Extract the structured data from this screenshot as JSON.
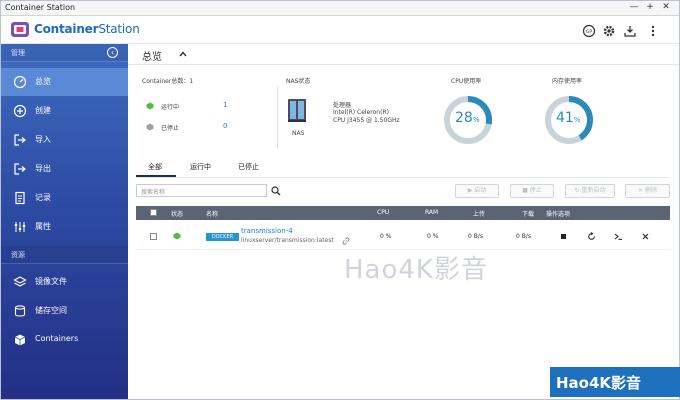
{
  "window": {
    "title": "Container Station",
    "controls": [
      "—",
      "+",
      "✕"
    ]
  },
  "header": {
    "brand_bold": "Container",
    "brand_thin": "Station"
  },
  "sidebar": {
    "section_manage": "管理",
    "section_resources": "资源",
    "items": [
      {
        "label": "总览",
        "icon": "dashboard-icon",
        "active": true
      },
      {
        "label": "创建",
        "icon": "create-icon",
        "active": false
      },
      {
        "label": "导入",
        "icon": "import-icon",
        "active": false
      },
      {
        "label": "导出",
        "icon": "export-icon",
        "active": false
      },
      {
        "label": "记录",
        "icon": "log-icon",
        "active": false
      },
      {
        "label": "属性",
        "icon": "properties-icon",
        "active": false
      }
    ],
    "resource_items": [
      {
        "label": "镜像文件",
        "icon": "layers-icon"
      },
      {
        "label": "储存空间",
        "icon": "storage-icon"
      },
      {
        "label": "Containers",
        "icon": "container-icon"
      }
    ]
  },
  "overview": {
    "title": "总览",
    "container_total_label": "Container总数：",
    "container_total": "1",
    "running_label": "运行中",
    "running_count": "1",
    "stopped_label": "已停止",
    "stopped_count": "0",
    "nas_status_label": "NAS状态",
    "nas_label": "NAS",
    "processor_label": "处理器",
    "processor_line1": "Intel(R) Celeron(R)",
    "processor_line2": "CPU J3455 @ 1.50GHz",
    "cpu_usage_label": "CPU使用率",
    "cpu_usage": "28",
    "mem_usage_label": "内存使用率",
    "mem_usage": "41",
    "pct": "%"
  },
  "tabs": [
    "全部",
    "运行中",
    "已停止"
  ],
  "search": {
    "placeholder": "搜索名称"
  },
  "actions": {
    "start": "启动",
    "stop": "停止",
    "restart": "重新启动",
    "delete": "删除"
  },
  "table": {
    "headers": {
      "status": "状态",
      "name": "名称",
      "cpu": "CPU",
      "ram": "RAM",
      "upload": "上传",
      "download": "下载",
      "ops": "操作选项"
    },
    "rows": [
      {
        "type": "DOCKER",
        "name": "transmission-4",
        "image": "linuxserver/transmission:latest",
        "cpu": "0 %",
        "ram": "0 %",
        "upload": "0 B/s",
        "download": "0 B/s"
      }
    ]
  },
  "watermark": {
    "mid": "Hao4K影音",
    "badge": "Hao4K影音"
  },
  "colors": {
    "accent": "#1c7fe0",
    "gauge": "#2b8bb5",
    "sidebar_top": "#3f6cc1",
    "sidebar_bottom": "#242f86"
  }
}
